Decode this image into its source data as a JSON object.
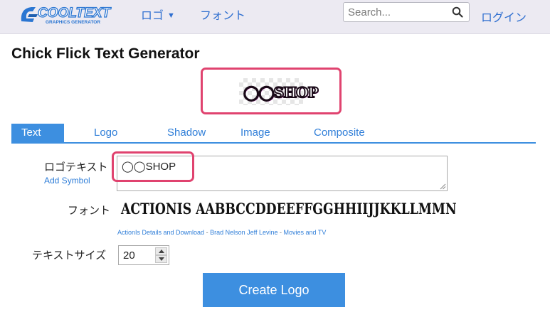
{
  "header": {
    "brand": "COOLTEXT",
    "brand_sub": "GRAPHICS GENERATOR",
    "nav_logo": "ロゴ",
    "nav_font": "フォント",
    "search_placeholder": "Search...",
    "login": "ログイン"
  },
  "page": {
    "title": "Chick Flick Text Generator",
    "preview_text": "◯◯SHOP"
  },
  "tabs": [
    {
      "label": "Text",
      "active": true
    },
    {
      "label": "Logo"
    },
    {
      "label": "Shadow"
    },
    {
      "label": "Image"
    },
    {
      "label": "Composite"
    }
  ],
  "form": {
    "logo_text_label": "ロゴテキスト",
    "add_symbol": "Add Symbol",
    "logo_text_value": "◯◯SHOP",
    "font_label": "フォント",
    "font_sample": "ACTIONIS AABBCCDDEEFFGGHHIIJJKKLLMMN",
    "font_details_link": "ActionIs Details and Download",
    "font_credit_sep1": " - ",
    "font_author_link": "Brad Nelson Jeff Levine",
    "font_credit_sep2": " - ",
    "font_category_link": "Movies and TV",
    "text_size_label": "テキストサイズ",
    "text_size_value": "20",
    "create_button": "Create Logo"
  },
  "colors": {
    "accent": "#3d8fe0",
    "link": "#2f7ed8",
    "highlight": "#e0436f",
    "navbar_bg": "#eceaf2"
  }
}
